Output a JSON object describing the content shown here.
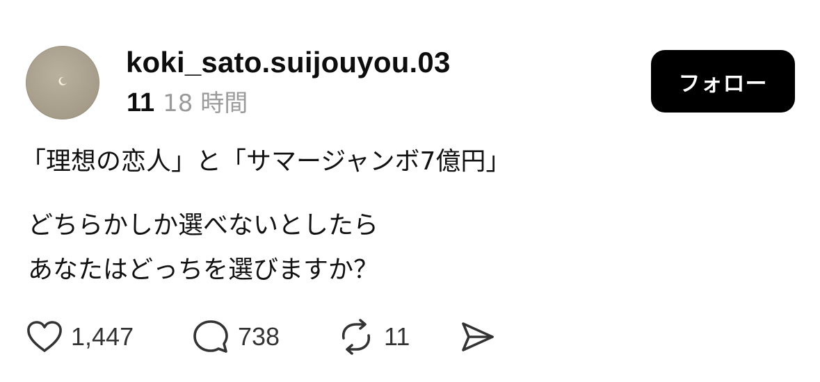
{
  "post": {
    "author": {
      "username": "koki_sato.suijouyou.03",
      "badge_number": "11",
      "time_ago": "18 時間"
    },
    "follow_label": "フォロー",
    "lines": [
      "「理想の恋人」と「サマージャンボ7億円」",
      "どちらかしか選べないとしたら",
      "あなたはどっちを選びますか？"
    ],
    "actions": {
      "likes": "1,447",
      "replies": "738",
      "reposts": "11"
    }
  },
  "icons": {
    "like": "heart-icon",
    "reply": "speech-bubble-icon",
    "repost": "repost-icon",
    "share": "send-icon"
  },
  "colors": {
    "follow_button_bg": "#000000",
    "follow_button_text": "#ffffff",
    "secondary_text": "#9a9a9a",
    "icon_stroke": "#333333"
  }
}
